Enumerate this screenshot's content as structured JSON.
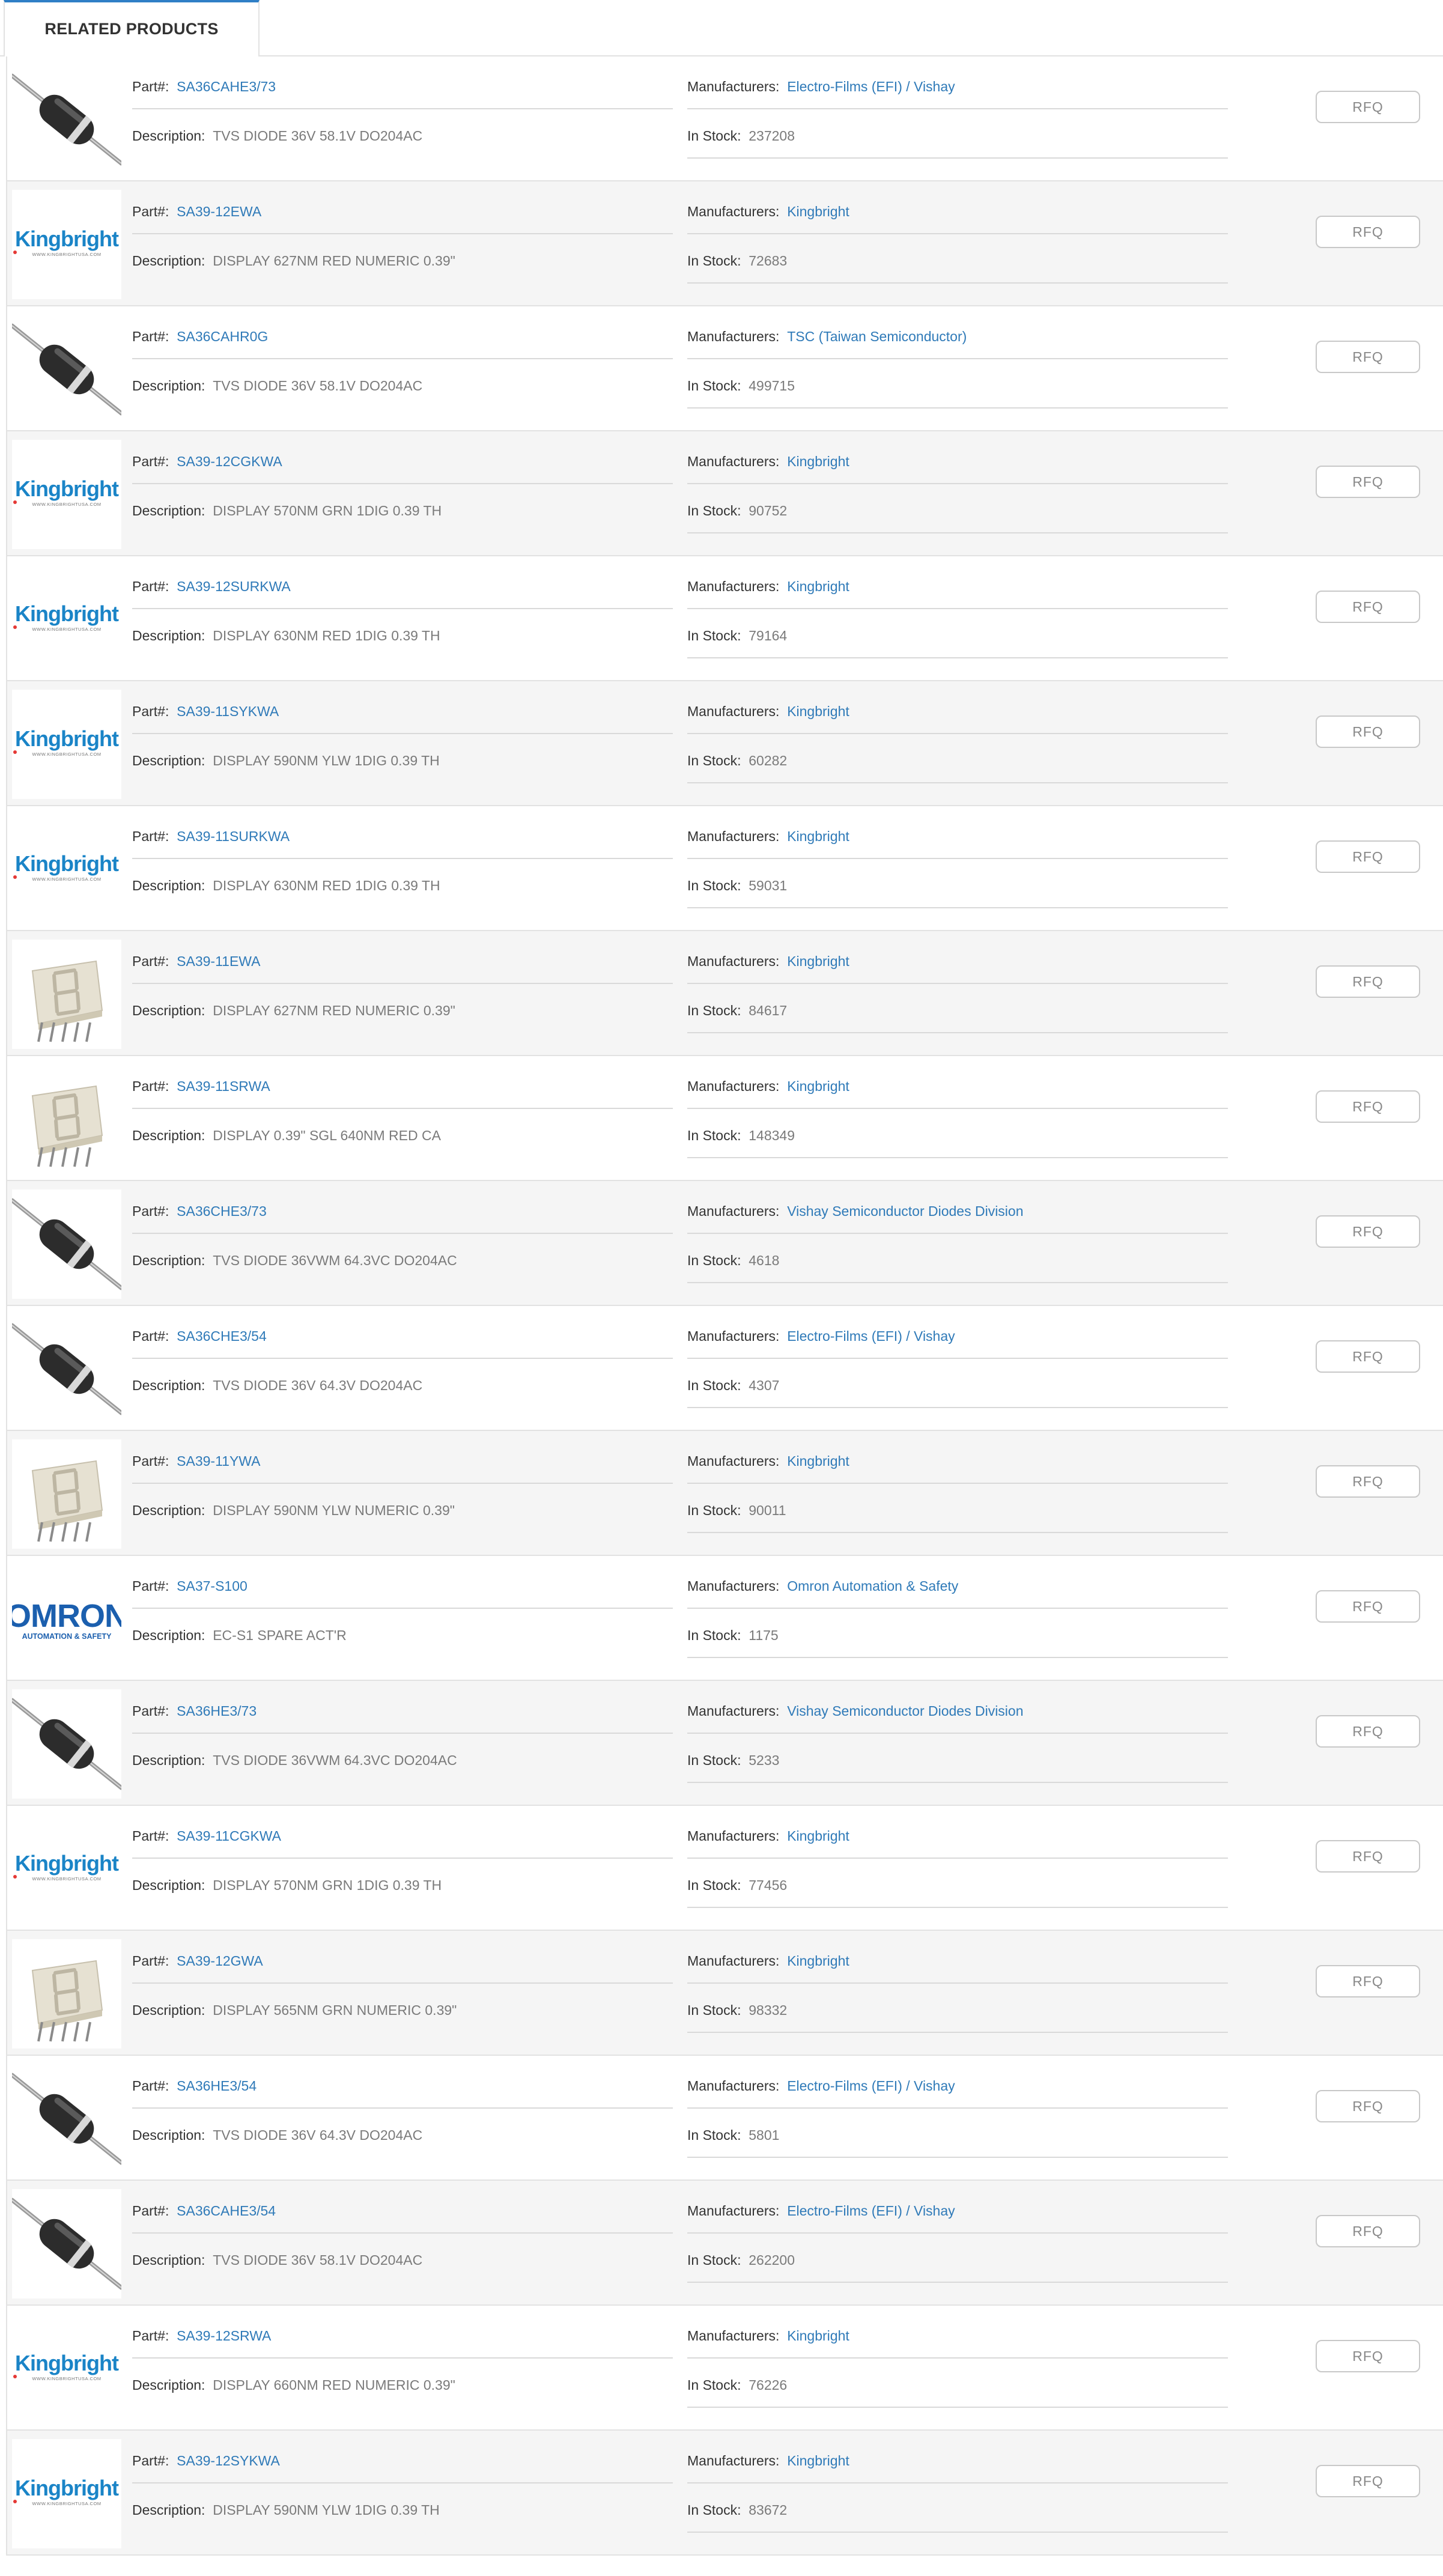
{
  "tab": {
    "label": "RELATED PRODUCTS"
  },
  "labels": {
    "part": "Part#:",
    "description": "Description:",
    "manufacturer": "Manufacturers:",
    "stock": "In Stock:",
    "rfq": "RFQ"
  },
  "colors": {
    "accent": "#2f7fc6",
    "link": "#2f7ab8",
    "kingbright_blue": "#1a84c7",
    "kingbright_red": "#e53935",
    "omron_blue": "#1b5fae"
  },
  "brand_logos": {
    "kingbright_name": "Kingbright",
    "kingbright_url": "WWW.KINGBRIGHTUSA.COM",
    "omron_name": "OMRON",
    "omron_tagline": "AUTOMATION & SAFETY"
  },
  "products": [
    {
      "part": "SA36CAHE3/73",
      "description": "TVS DIODE 36V 58.1V DO204AC",
      "manufacturer": "Electro-Films (EFI) / Vishay",
      "stock": "237208",
      "image": "diode-icon"
    },
    {
      "part": "SA39-12EWA",
      "description": "DISPLAY 627NM RED NUMERIC 0.39\"",
      "manufacturer": "Kingbright",
      "stock": "72683",
      "image": "kingbright-logo"
    },
    {
      "part": "SA36CAHR0G",
      "description": "TVS DIODE 36V 58.1V DO204AC",
      "manufacturer": "TSC (Taiwan Semiconductor)",
      "stock": "499715",
      "image": "diode-icon"
    },
    {
      "part": "SA39-12CGKWA",
      "description": "DISPLAY 570NM GRN 1DIG 0.39 TH",
      "manufacturer": "Kingbright",
      "stock": "90752",
      "image": "kingbright-logo"
    },
    {
      "part": "SA39-12SURKWA",
      "description": "DISPLAY 630NM RED 1DIG 0.39 TH",
      "manufacturer": "Kingbright",
      "stock": "79164",
      "image": "kingbright-logo"
    },
    {
      "part": "SA39-11SYKWA",
      "description": "DISPLAY 590NM YLW 1DIG 0.39 TH",
      "manufacturer": "Kingbright",
      "stock": "60282",
      "image": "kingbright-logo"
    },
    {
      "part": "SA39-11SURKWA",
      "description": "DISPLAY 630NM RED 1DIG 0.39 TH",
      "manufacturer": "Kingbright",
      "stock": "59031",
      "image": "kingbright-logo"
    },
    {
      "part": "SA39-11EWA",
      "description": "DISPLAY 627NM RED NUMERIC 0.39\"",
      "manufacturer": "Kingbright",
      "stock": "84617",
      "image": "seven-segment-icon"
    },
    {
      "part": "SA39-11SRWA",
      "description": "DISPLAY 0.39\" SGL 640NM RED CA",
      "manufacturer": "Kingbright",
      "stock": "148349",
      "image": "seven-segment-icon"
    },
    {
      "part": "SA36CHE3/73",
      "description": "TVS DIODE 36VWM 64.3VC DO204AC",
      "manufacturer": "Vishay Semiconductor Diodes Division",
      "stock": "4618",
      "image": "diode-icon"
    },
    {
      "part": "SA36CHE3/54",
      "description": "TVS DIODE 36V 64.3V DO204AC",
      "manufacturer": "Electro-Films (EFI) / Vishay",
      "stock": "4307",
      "image": "diode-icon"
    },
    {
      "part": "SA39-11YWA",
      "description": "DISPLAY 590NM YLW NUMERIC 0.39\"",
      "manufacturer": "Kingbright",
      "stock": "90011",
      "image": "seven-segment-icon"
    },
    {
      "part": "SA37-S100",
      "description": "EC-S1 SPARE ACT'R",
      "manufacturer": "Omron Automation & Safety",
      "stock": "1175",
      "image": "omron-logo"
    },
    {
      "part": "SA36HE3/73",
      "description": "TVS DIODE 36VWM 64.3VC DO204AC",
      "manufacturer": "Vishay Semiconductor Diodes Division",
      "stock": "5233",
      "image": "diode-icon"
    },
    {
      "part": "SA39-11CGKWA",
      "description": "DISPLAY 570NM GRN 1DIG 0.39 TH",
      "manufacturer": "Kingbright",
      "stock": "77456",
      "image": "kingbright-logo"
    },
    {
      "part": "SA39-12GWA",
      "description": "DISPLAY 565NM GRN NUMERIC 0.39\"",
      "manufacturer": "Kingbright",
      "stock": "98332",
      "image": "seven-segment-icon"
    },
    {
      "part": "SA36HE3/54",
      "description": "TVS DIODE 36V 64.3V DO204AC",
      "manufacturer": "Electro-Films (EFI) / Vishay",
      "stock": "5801",
      "image": "diode-icon"
    },
    {
      "part": "SA36CAHE3/54",
      "description": "TVS DIODE 36V 58.1V DO204AC",
      "manufacturer": "Electro-Films (EFI) / Vishay",
      "stock": "262200",
      "image": "diode-icon"
    },
    {
      "part": "SA39-12SRWA",
      "description": "DISPLAY 660NM RED NUMERIC 0.39\"",
      "manufacturer": "Kingbright",
      "stock": "76226",
      "image": "kingbright-logo"
    },
    {
      "part": "SA39-12SYKWA",
      "description": "DISPLAY 590NM YLW 1DIG 0.39 TH",
      "manufacturer": "Kingbright",
      "stock": "83672",
      "image": "kingbright-logo"
    }
  ]
}
